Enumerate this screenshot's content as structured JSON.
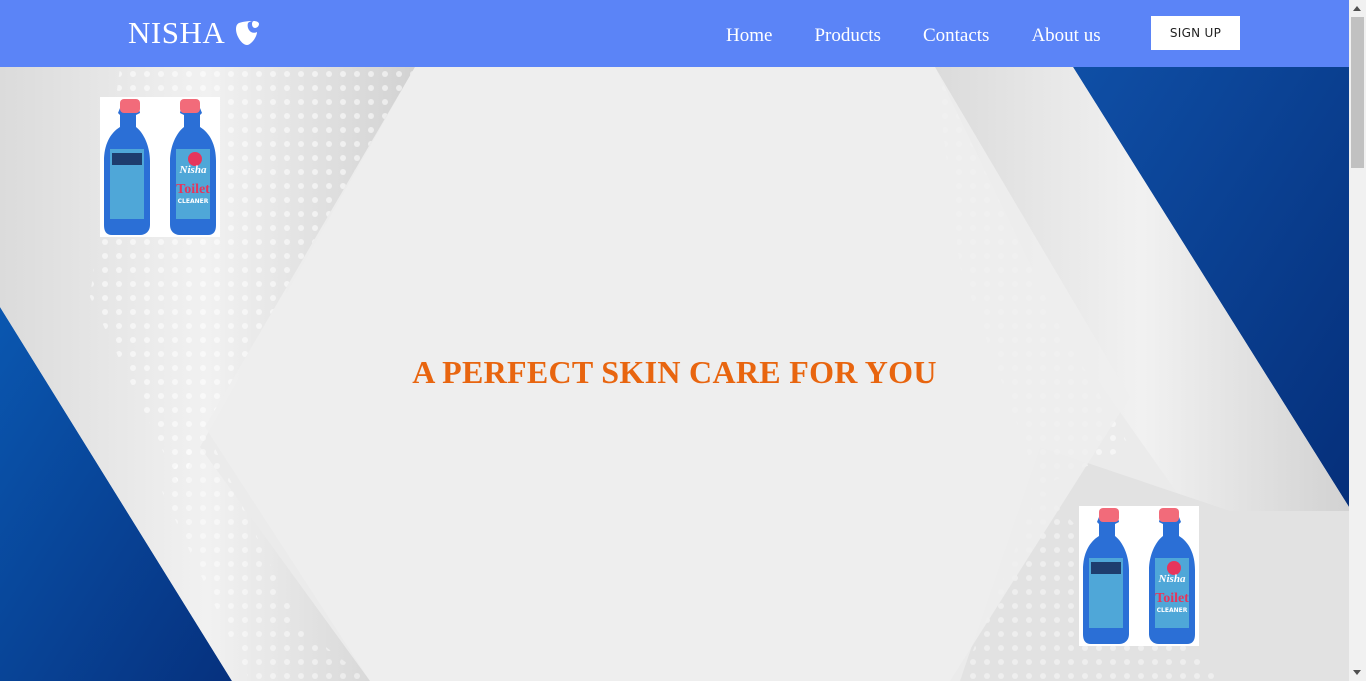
{
  "brand": {
    "name": "NISHA",
    "icon": "typo3-logo-icon"
  },
  "nav": {
    "items": [
      {
        "label": "Home"
      },
      {
        "label": "Products"
      },
      {
        "label": "Contacts"
      },
      {
        "label": "About us"
      }
    ],
    "signup_label": "SIGN UP"
  },
  "hero": {
    "headline": "A PERFECT SKIN CARE FOR YOU",
    "product_image": {
      "brand": "Nisha",
      "name": "Toilet",
      "subname": "CLEANER"
    }
  },
  "colors": {
    "navbar": "#5b84f7",
    "headline": "#e8650f",
    "accent_blue": "#0a3d9a"
  }
}
